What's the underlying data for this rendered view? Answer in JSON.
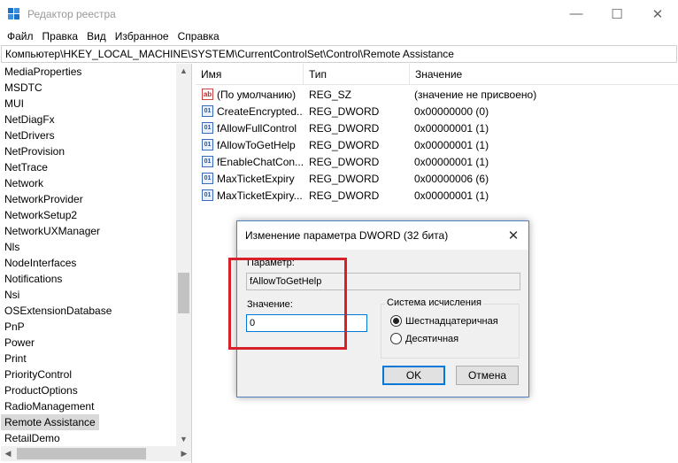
{
  "window": {
    "title": "Редактор реестра",
    "minimize_icon": "minimize-icon",
    "maximize_icon": "maximize-icon",
    "close_icon": "close-icon"
  },
  "menu": [
    "Файл",
    "Правка",
    "Вид",
    "Избранное",
    "Справка"
  ],
  "address": "Компьютер\\HKEY_LOCAL_MACHINE\\SYSTEM\\CurrentControlSet\\Control\\Remote Assistance",
  "tree": {
    "items": [
      "MediaProperties",
      "MSDTC",
      "MUI",
      "NetDiagFx",
      "NetDrivers",
      "NetProvision",
      "NetTrace",
      "Network",
      "NetworkProvider",
      "NetworkSetup2",
      "NetworkUXManager",
      "Nls",
      "NodeInterfaces",
      "Notifications",
      "Nsi",
      "OSExtensionDatabase",
      "PnP",
      "Power",
      "Print",
      "PriorityControl",
      "ProductOptions",
      "RadioManagement",
      "Remote Assistance",
      "RetailDemo"
    ],
    "selected": "Remote Assistance"
  },
  "values": {
    "headers": {
      "name": "Имя",
      "type": "Тип",
      "data": "Значение"
    },
    "rows": [
      {
        "name": "(По умолчанию)",
        "type": "REG_SZ",
        "data": "(значение не присвоено)",
        "icon": "string-value-icon"
      },
      {
        "name": "CreateEncrypted...",
        "type": "REG_DWORD",
        "data": "0x00000000 (0)",
        "icon": "binary-value-icon"
      },
      {
        "name": "fAllowFullControl",
        "type": "REG_DWORD",
        "data": "0x00000001 (1)",
        "icon": "binary-value-icon"
      },
      {
        "name": "fAllowToGetHelp",
        "type": "REG_DWORD",
        "data": "0x00000001 (1)",
        "icon": "binary-value-icon"
      },
      {
        "name": "fEnableChatCon...",
        "type": "REG_DWORD",
        "data": "0x00000001 (1)",
        "icon": "binary-value-icon"
      },
      {
        "name": "MaxTicketExpiry",
        "type": "REG_DWORD",
        "data": "0x00000006 (6)",
        "icon": "binary-value-icon"
      },
      {
        "name": "MaxTicketExpiry...",
        "type": "REG_DWORD",
        "data": "0x00000001 (1)",
        "icon": "binary-value-icon"
      }
    ]
  },
  "dialog": {
    "title": "Изменение параметра DWORD (32 бита)",
    "param_label": "Параметр:",
    "param_value": "fAllowToGetHelp",
    "value_label": "Значение:",
    "value_input": "0",
    "base_group": "Система исчисления",
    "radio_hex": "Шестнадцатеричная",
    "radio_dec": "Десятичная",
    "selected_base": "hex",
    "ok": "OK",
    "cancel": "Отмена"
  },
  "colors": {
    "highlight": "#d6202a",
    "focus_border": "#0078d7"
  }
}
